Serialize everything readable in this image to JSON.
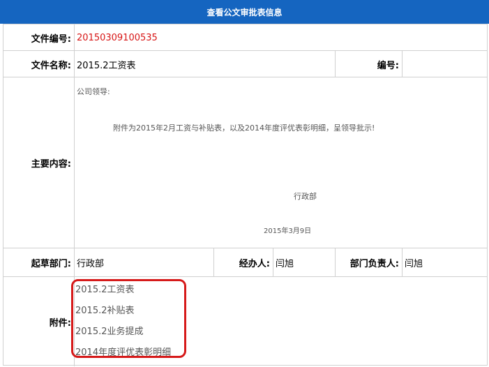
{
  "header": {
    "title": "查看公文审批表信息"
  },
  "doc_number": {
    "label": "文件编号:",
    "value": "20150309100535"
  },
  "doc_name": {
    "label": "文件名称:",
    "value": "2015.2工资表",
    "number_label": "编号:",
    "number_value": ""
  },
  "main_content": {
    "label": "主要内容:",
    "greeting": "公司领导:",
    "body": "附件为2015年2月工资与补贴表，以及2014年度评优表彰明细，呈领导批示!",
    "department": "行政部",
    "date": "2015年3月9日"
  },
  "draft": {
    "dept_label": "起草部门:",
    "dept_value": "行政部",
    "handler_label": "经办人:",
    "handler_value": "闫旭",
    "manager_label": "部门负责人:",
    "manager_value": "闫旭"
  },
  "attachments": {
    "label": "附件:",
    "items": [
      "2015.2工资表",
      "2015.2补贴表",
      "2015.2业务提成",
      "2014年度评优表彰明细"
    ]
  }
}
